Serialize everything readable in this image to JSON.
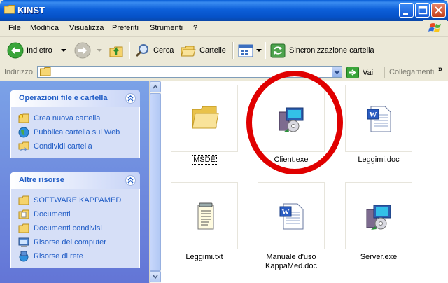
{
  "window": {
    "title": "KINST"
  },
  "menu": [
    "File",
    "Modifica",
    "Visualizza",
    "Preferiti",
    "Strumenti",
    "?"
  ],
  "toolbar": {
    "back_label": "Indietro",
    "search_label": "Cerca",
    "folders_label": "Cartelle",
    "sync_label": "Sincronizzazione cartella"
  },
  "address": {
    "label": "Indirizzo",
    "value": "",
    "go_label": "Vai",
    "links_label": "Collegamenti"
  },
  "taskpane": {
    "file_tasks": {
      "title": "Operazioni file e cartella",
      "items": [
        "Crea nuova cartella",
        "Pubblica cartella sul Web",
        "Condividi cartella"
      ]
    },
    "other_places": {
      "title": "Altre risorse",
      "items": [
        "SOFTWARE KAPPAMED",
        "Documenti",
        "Documenti condivisi",
        "Risorse del computer",
        "Risorse di rete"
      ]
    }
  },
  "files": [
    {
      "name": "MSDE",
      "icon": "folder-icon"
    },
    {
      "name": "Client.exe",
      "icon": "installer-icon"
    },
    {
      "name": "Leggimi.doc",
      "icon": "word-document-icon"
    },
    {
      "name": "Leggimi.txt",
      "icon": "text-file-icon"
    },
    {
      "name": "Manuale d'uso KappaMed.doc",
      "icon": "word-document-icon"
    },
    {
      "name": "Server.exe",
      "icon": "installer-icon"
    }
  ],
  "colors": {
    "titlebar": "#0a5fd8",
    "taskpane": "#7ba2e7",
    "panel_title": "#215dc6",
    "highlight_circle": "#e00000"
  }
}
